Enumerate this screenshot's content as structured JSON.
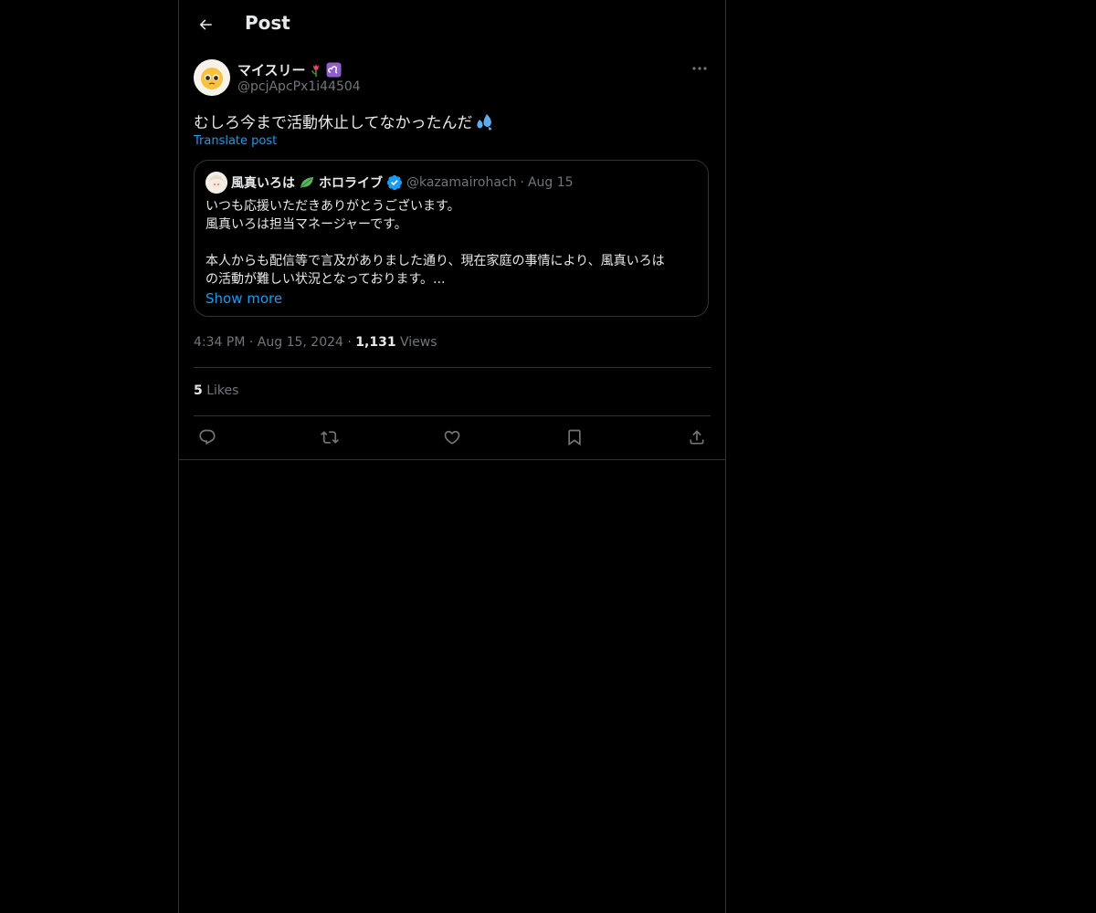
{
  "header": {
    "title": "Post"
  },
  "post": {
    "author_name": "マイスリー",
    "author_handle": "@pcjApcPx1i44504",
    "text": "むしろ今まで活動休止してなかったんだ",
    "translate_label": "Translate post",
    "timestamp": "4:34 PM",
    "date": "Aug 15, 2024",
    "views_count": "1,131",
    "views_label": "Views",
    "likes_count": "5",
    "likes_label": "Likes"
  },
  "quote": {
    "author_name": "風真いろは",
    "author_suffix": "ホロライブ",
    "handle": "@kazamairohach",
    "date": "Aug 15",
    "lines": [
      "いつも応援いただきありがとうございます。",
      "風真いろは担当マネージャーです。",
      "",
      "本人からも配信等で言及がありました通り、現在家庭の事情により、風真いろは",
      "の活動が難しい状況となっております。..."
    ],
    "show_more_label": "Show more"
  },
  "colors": {
    "background": "#000000",
    "text_primary": "#e7e9ea",
    "text_secondary": "#71767b",
    "accent": "#1d9bf0",
    "border": "#2f3336"
  },
  "icons": {
    "back": "arrow-left-icon",
    "more": "more-horizontal-icon",
    "reply": "reply-icon",
    "repost": "repost-icon",
    "like": "heart-icon",
    "bookmark": "bookmark-icon",
    "share": "share-icon",
    "verified": "verified-badge-icon"
  }
}
